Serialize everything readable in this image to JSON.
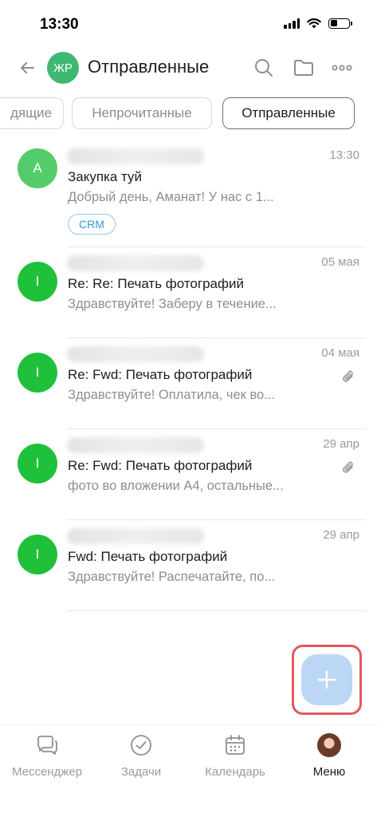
{
  "status_bar": {
    "time": "13:30"
  },
  "header": {
    "account_initials": "ЖР",
    "account_color": "#3fb873",
    "title": "Отправленные",
    "icons": [
      "back-arrow-icon",
      "search-icon",
      "folder-icon",
      "more-icon"
    ]
  },
  "filters": [
    {
      "label": "дящие",
      "active": false
    },
    {
      "label": "Непрочитанные",
      "active": false
    },
    {
      "label": "Отправленные",
      "active": true
    }
  ],
  "messages": [
    {
      "initial": "A",
      "avatar_color": "#55cc6b",
      "date": "13:30",
      "subject": "Закупка туй",
      "preview": "Добрый день, Аманат!   У нас с 1...",
      "badge": "CRM",
      "has_attachment": false
    },
    {
      "initial": "I",
      "avatar_color": "#1fc13b",
      "date": "05 мая",
      "subject": "Re: Re: Печать фотографий",
      "preview": "Здравствуйте! Заберу в течение...",
      "has_attachment": false
    },
    {
      "initial": "I",
      "avatar_color": "#1fc13b",
      "date": "04 мая",
      "subject": "Re: Fwd: Печать фотографий",
      "preview": "Здравствуйте! Оплатила, чек во...",
      "has_attachment": true
    },
    {
      "initial": "I",
      "avatar_color": "#1fc13b",
      "date": "29 апр",
      "subject": "Re: Fwd: Печать фотографий",
      "preview": "фото во вложении А4, остальные...",
      "has_attachment": true
    },
    {
      "initial": "I",
      "avatar_color": "#1fc13b",
      "date": "29 апр",
      "subject": "Fwd: Печать фотографий",
      "preview": "Здравствуйте! Распечатайте, по...",
      "has_attachment": false
    }
  ],
  "fab": {
    "icon": "plus-icon",
    "color": "#bcd7f5",
    "highlight_color": "#e2595c"
  },
  "bottom_nav": [
    {
      "label": "Мессенджер",
      "icon": "messenger-icon",
      "active": false
    },
    {
      "label": "Задачи",
      "icon": "tasks-check-icon",
      "active": false
    },
    {
      "label": "Календарь",
      "icon": "calendar-icon",
      "active": false
    },
    {
      "label": "Меню",
      "icon": "user-avatar",
      "active": true
    }
  ]
}
